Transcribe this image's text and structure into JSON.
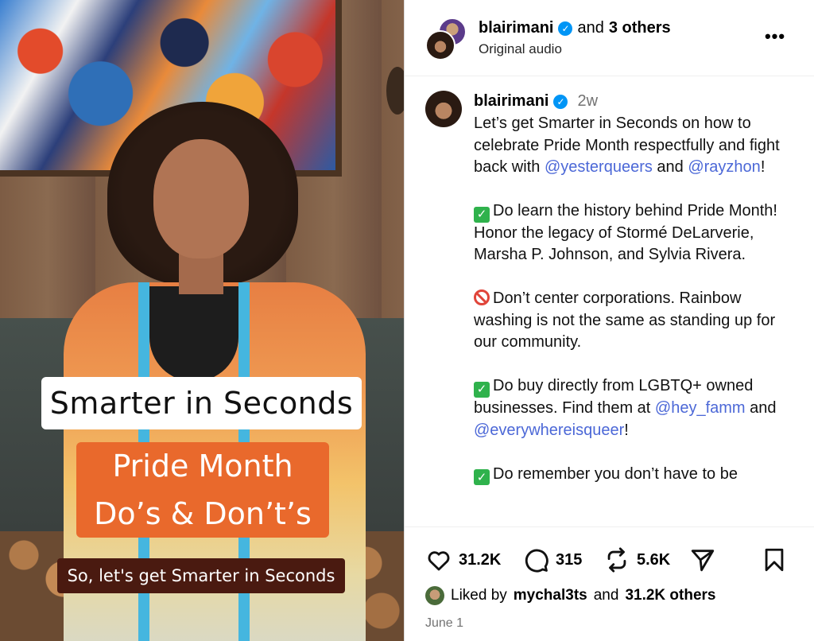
{
  "media": {
    "overlay_title": "Smarter in Seconds",
    "overlay_orange_line1": "Pride Month",
    "overlay_orange_line2": "Do’s & Don’t’s",
    "overlay_caption": "So, let's get Smarter in Seconds"
  },
  "header": {
    "username": "blairimani",
    "collab_suffix": "and",
    "collab_others": "3 others",
    "subtitle": "Original audio",
    "more_icon": "more-horizontal-icon"
  },
  "caption": {
    "username": "blairimani",
    "time_ago": "2w",
    "p1_a": "Let’s get Smarter in Seconds on how to celebrate Pride Month respectfully and fight back with ",
    "p1_mention1": "@yesterqueers",
    "p1_b": " and ",
    "p1_mention2": "@rayzhon",
    "p1_c": "!",
    "p2": "Do learn the history behind Pride Month! Honor the legacy of Stormé DeLarverie, Marsha P. Johnson, and Sylvia Rivera.",
    "p3": "Don’t center corporations. Rainbow washing is not the same as standing up for our community.",
    "p4_a": "Do buy directly from LGBTQ+ owned businesses. Find them at ",
    "p4_mention1": "@hey_famm",
    "p4_b": " and ",
    "p4_mention2": "@everywhereisqueer",
    "p4_c": "!",
    "p5": "Do remember you don’t have to be"
  },
  "actions": {
    "likes": "31.2K",
    "comments": "315",
    "reposts": "5.6K",
    "liked_by_prefix": "Liked by",
    "liked_by_user": "mychal3ts",
    "liked_by_and": "and",
    "liked_by_others": "31.2K others",
    "date": "June 1"
  },
  "colors": {
    "mention": "#4c68d7",
    "verified": "#0095f6",
    "overlay_orange": "#e9692c",
    "overlay_caption_bg": "#4a1a10"
  }
}
